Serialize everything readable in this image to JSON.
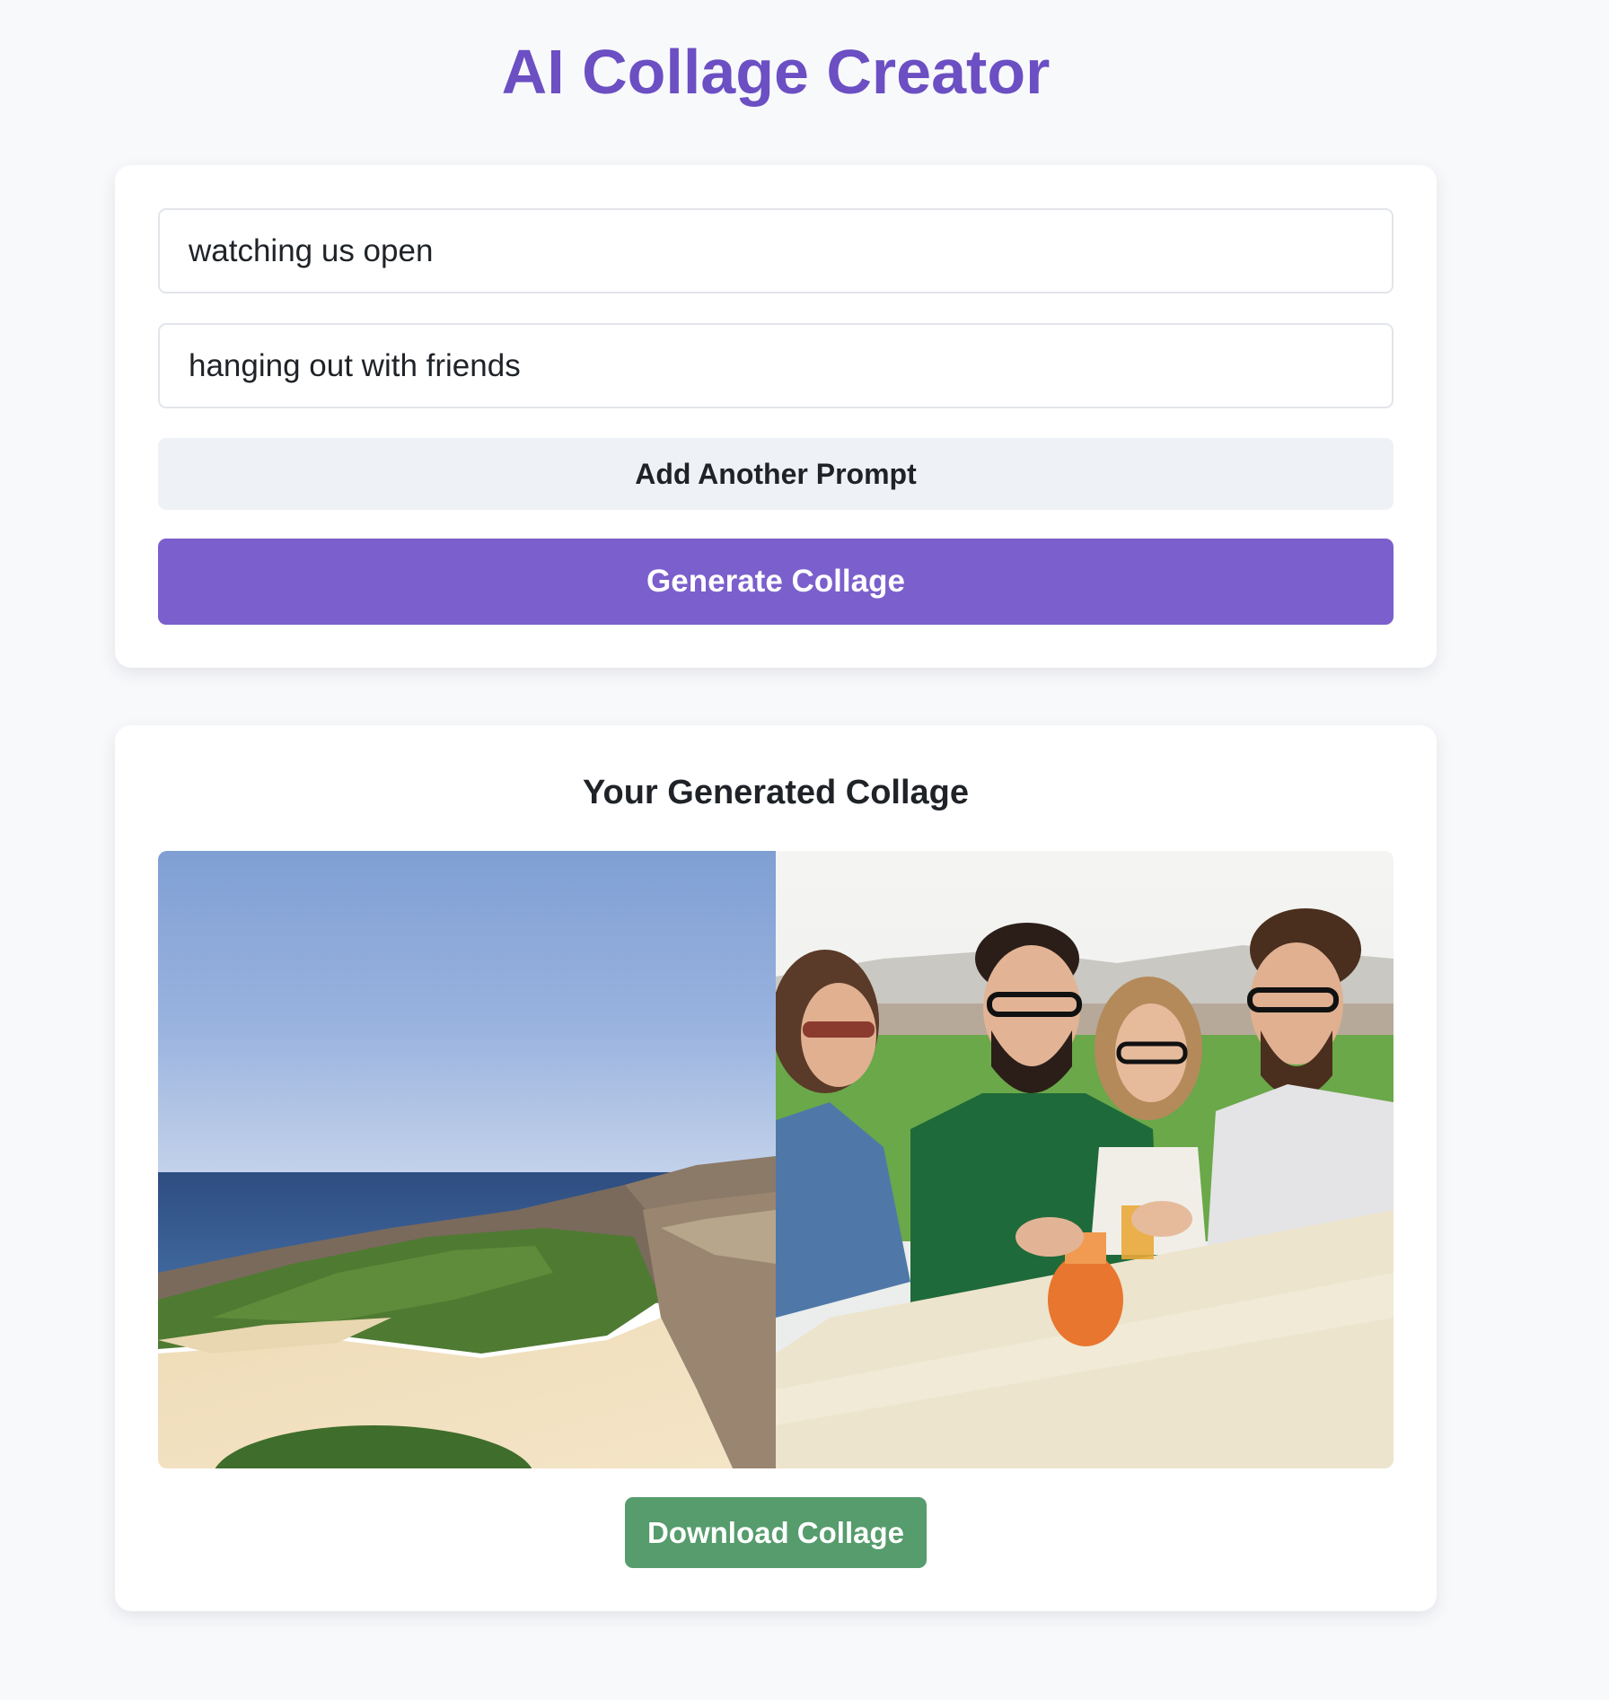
{
  "app": {
    "title": "AI Collage Creator",
    "accent_color": "#6b4fc3"
  },
  "form": {
    "prompts": [
      {
        "value": "watching us open"
      },
      {
        "value": "hanging out with friends"
      }
    ],
    "add_prompt_label": "Add Another Prompt",
    "generate_label": "Generate Collage",
    "generate_color": "#7b5fcc"
  },
  "result": {
    "heading": "Your Generated Collage",
    "download_label": "Download Collage",
    "download_color": "#569c6c",
    "images": [
      {
        "name": "collage-image-golf-course",
        "depicts": "coastal golf course on cliffs"
      },
      {
        "name": "collage-image-friends",
        "depicts": "four friends at an outdoor table"
      }
    ]
  }
}
